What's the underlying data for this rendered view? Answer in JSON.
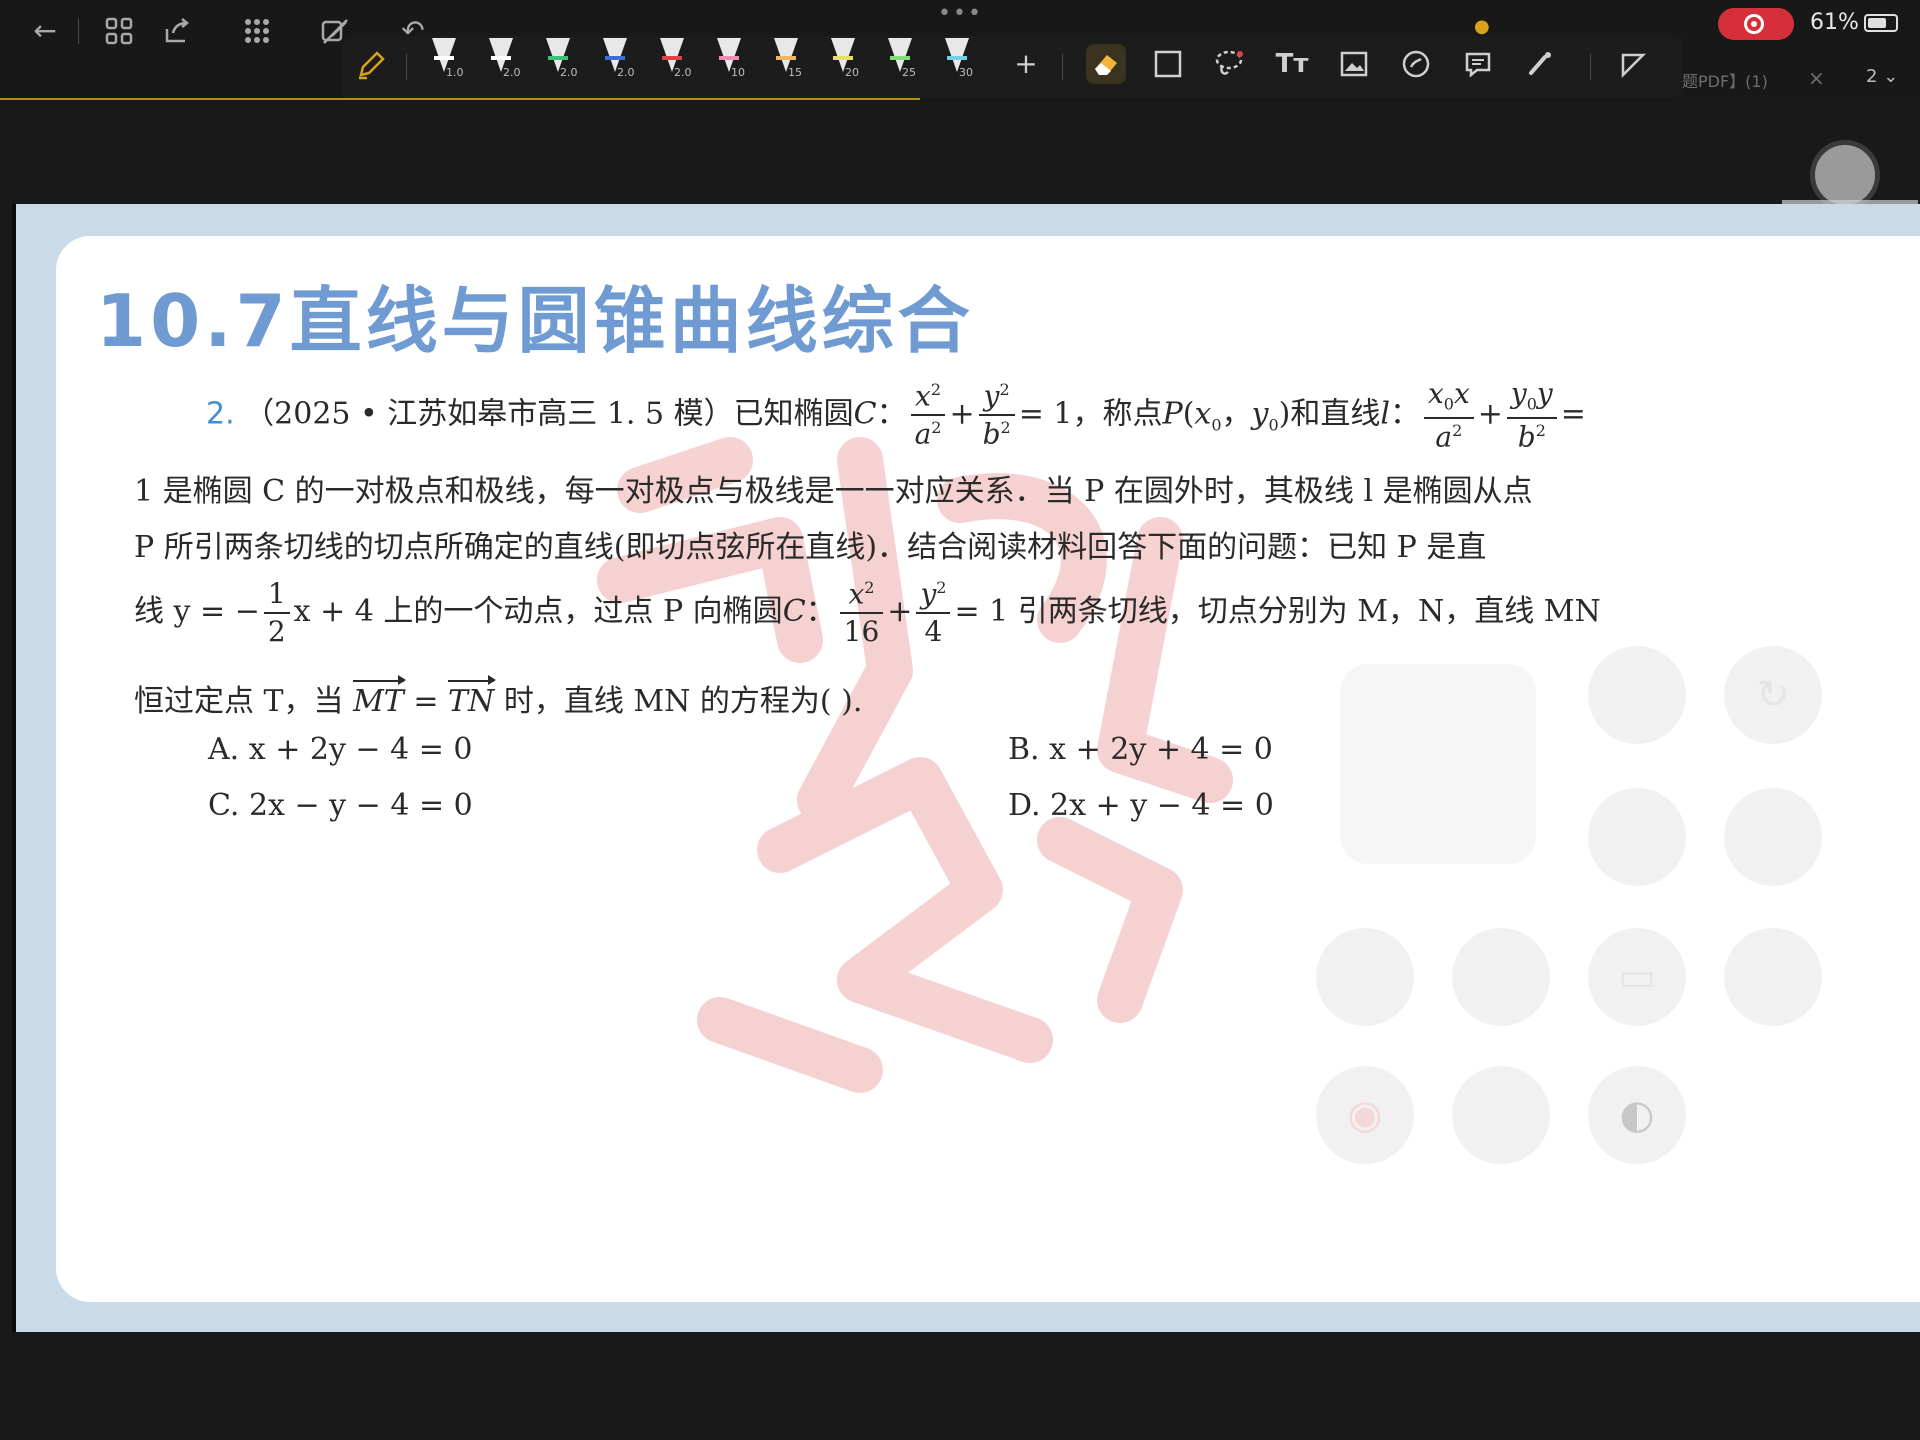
{
  "topbar": {
    "back_icon": "arrow-left-icon",
    "grid_icon": "grid-icon",
    "export_icon": "export-icon",
    "apps_icon": "apps-icon",
    "edit_icon": "edit-off-icon",
    "undo_icon": "undo-icon",
    "doc_tab_label": "题PDF】(1)",
    "doc_tab_close": "×",
    "page_number": "2"
  },
  "pen_toolbar": {
    "pens": [
      {
        "size": "1.0",
        "color": "#ffffff"
      },
      {
        "size": "2.0",
        "color": "#ffffff"
      },
      {
        "size": "2.0",
        "color": "#3fbf7a"
      },
      {
        "size": "2.0",
        "color": "#3b6fd1"
      },
      {
        "size": "2.0",
        "color": "#e04444"
      },
      {
        "size": "10",
        "color": "#f08bb2"
      },
      {
        "size": "15",
        "color": "#f2b560"
      },
      {
        "size": "20",
        "color": "#e8e05a"
      },
      {
        "size": "25",
        "color": "#7fe07a"
      },
      {
        "size": "30",
        "color": "#6fd3e8"
      }
    ],
    "add_label": "+",
    "tools": [
      "eraser-icon",
      "rectangle-icon",
      "lasso-icon",
      "text-icon",
      "image-icon",
      "sticker-icon",
      "comment-icon",
      "laser-pointer-icon",
      "shape-icon"
    ],
    "text_tool_label": "Tт"
  },
  "status": {
    "battery": "61%",
    "recording": true
  },
  "page": {
    "section_title": "10.7直线与圆锥曲线综合",
    "question_number": "2.",
    "line1_a": "（2025 • 江苏如皋市高三 1. 5 模）已知椭圆",
    "line1_b": "，称点",
    "line1_c": "和直线",
    "line2": "1 是椭圆 C 的一对极点和极线，每一对极点与极线是一一对应关系．当 P 在圆外时，其极线 l 是椭圆从点",
    "line3": "P 所引两条切线的切点所确定的直线(即切点弦所在直线)．结合阅读材料回答下面的问题：已知 P 是直",
    "line4_a": "线 y = −",
    "line4_b": "x + 4 上的一个动点，过点 P 向椭圆",
    "line4_c": "= 1 引两条切线，切点分别为 M，N，直线 MN",
    "line5_a": "恒过定点 T，当",
    "line5_b": "时，直线 MN 的方程为(        ).",
    "options": {
      "A": "A.  x + 2y − 4 = 0",
      "B": "B.  x + 2y + 4 = 0",
      "C": "C.  2x − y − 4 = 0",
      "D": "D.  2x + y − 4 = 0"
    }
  },
  "colors": {
    "title_blue": "#6f9bd2",
    "question_number_blue": "#3e8ed6",
    "page_frame": "#c9dbe9",
    "record_red": "#d5303a",
    "watermark_red": "#f3c6c6"
  }
}
